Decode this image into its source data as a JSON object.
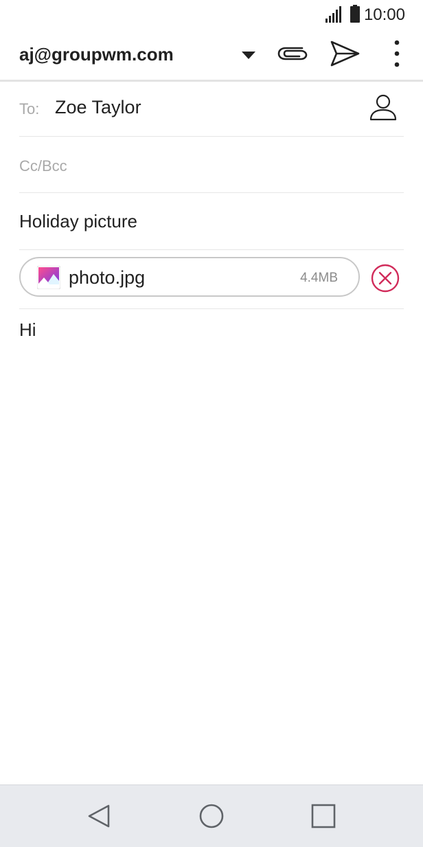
{
  "status_bar": {
    "time": "10:00",
    "icons": [
      "signal-icon",
      "battery-icon"
    ]
  },
  "app_bar": {
    "account": "aj@groupwm.com",
    "icons": [
      "dropdown-arrow-icon",
      "paperclip-icon",
      "send-icon",
      "more-vert-icon"
    ]
  },
  "compose": {
    "to_label": "To:",
    "to_value": "Zoe Taylor",
    "cc_label": "Cc/Bcc",
    "subject": "Holiday picture",
    "attachment": {
      "name": "photo.jpg",
      "size": "4.4MB"
    },
    "body": "Hi"
  },
  "colors": {
    "accent_remove": "#d12b5a",
    "divider": "#e6e6e6",
    "hint_text": "#a9a9a9",
    "nav_bar_bg": "#e8eaee"
  },
  "nav_bar": {
    "icons": [
      "back-icon",
      "home-icon",
      "recents-icon"
    ]
  }
}
